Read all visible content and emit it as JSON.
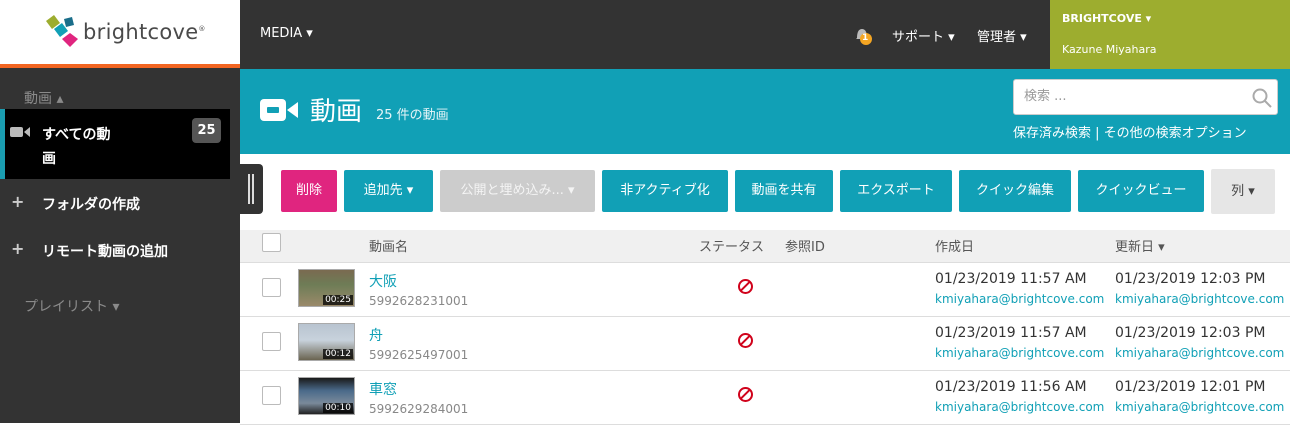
{
  "brand": {
    "name": "brightcove",
    "mark": "®"
  },
  "topnav": {
    "media": "MEDIA ▾",
    "notification_count": "1",
    "support": "サポート ▾",
    "admin": "管理者 ▾",
    "account_name": "BRIGHTCOVE ▾",
    "user_name": "Kazune Miyahara"
  },
  "sidebar": {
    "section_videos": "動画 ▴",
    "all_videos_line1": "すべての動",
    "all_videos_line2": "画",
    "all_videos_count": "25",
    "create_folder": "フォルダの作成",
    "add_remote": "リモート動画の追加",
    "section_playlists": "プレイリスト ▾",
    "plus": "+"
  },
  "header": {
    "title": "動画",
    "count": "25 件の動画",
    "search_placeholder": "検索 ...",
    "saved_search": "保存済み検索 | その他の検索オプション"
  },
  "toolbar": {
    "delete": "削除",
    "add_to": "追加先 ▾",
    "publish_embed": "公開と埋め込み... ▾",
    "deactivate": "非アクティブ化",
    "share": "動画を共有",
    "export": "エクスポート",
    "quick_edit": "クイック編集",
    "quick_view": "クイックビュー",
    "columns": "列 ▾"
  },
  "table": {
    "columns": {
      "name": "動画名",
      "status": "ステータス",
      "ref_id": "参照ID",
      "created": "作成日",
      "updated": "更新日 ▾"
    },
    "rows": [
      {
        "name": "大阪",
        "id": "5992628231001",
        "duration": "00:25",
        "created": "01/23/2019 11:57 AM",
        "created_by": "kmiyahara@brightcove.com",
        "updated": "01/23/2019 12:03 PM",
        "updated_by": "kmiyahara@brightcove.com"
      },
      {
        "name": "舟",
        "id": "5992625497001",
        "duration": "00:12",
        "created": "01/23/2019 11:57 AM",
        "created_by": "kmiyahara@brightcove.com",
        "updated": "01/23/2019 12:03 PM",
        "updated_by": "kmiyahara@brightcove.com"
      },
      {
        "name": "車窓",
        "id": "5992629284001",
        "duration": "00:10",
        "created": "01/23/2019 11:56 AM",
        "created_by": "kmiyahara@brightcove.com",
        "updated": "01/23/2019 12:01 PM",
        "updated_by": "kmiyahara@brightcove.com"
      }
    ]
  },
  "colors": {
    "teal": "#11a0b6",
    "magenta": "#e0257f",
    "olive": "#9dad2f",
    "orange": "#f26522"
  }
}
